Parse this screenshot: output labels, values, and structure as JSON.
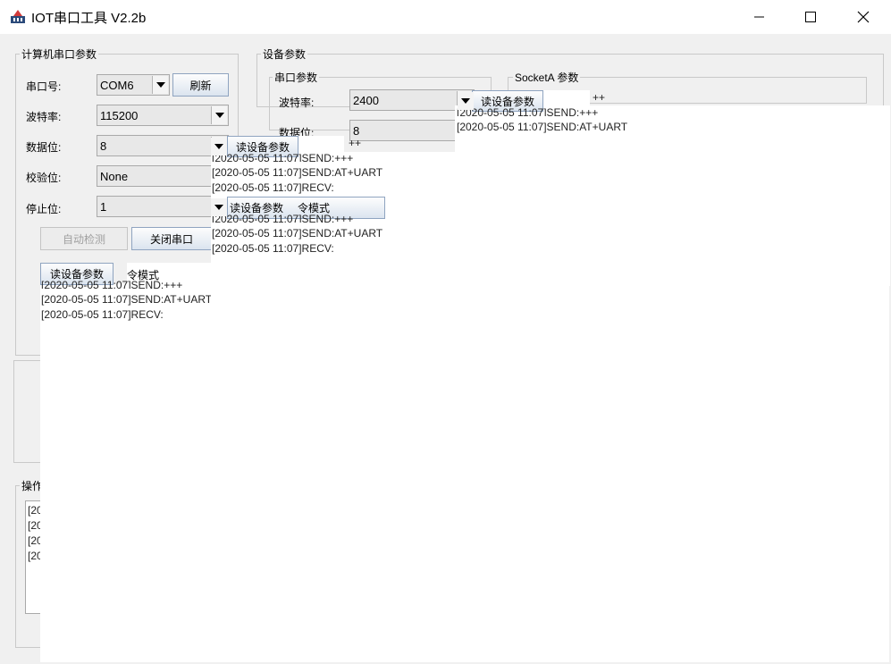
{
  "window": {
    "title": "IOT串口工具 V2.2b"
  },
  "computer_serial": {
    "group_title": "计算机串口参数",
    "port_label": "串口号:",
    "port_value": "COM6",
    "refresh_label": "刷新",
    "baud_label": "波特率:",
    "baud_value": "115200",
    "data_bits_label": "数据位:",
    "data_bits_value": "8",
    "parity_label": "校验位:",
    "parity_value": "None",
    "stop_bits_label": "停止位:",
    "stop_bits_value": "1",
    "auto_detect_label": "自动检测",
    "close_port_label": "关闭串口",
    "read_params_label": "读设备参数",
    "cmd_mode_fragment": "令模式"
  },
  "device_params": {
    "group_title": "设备参数",
    "serial_group_title": "串口参数",
    "baud_label": "波特率:",
    "baud_value": "2400",
    "data_bits_label": "数据位:",
    "data_bits_value": "8",
    "sockets_group_title": "SocketA 参数",
    "read_params_label": "读设备参数"
  },
  "operation_log": {
    "group_title_fragment": "操作",
    "line_fragment": "[20"
  },
  "ghost_artifacts": [
    {
      "read_label": "读设备参数",
      "lines": [
        "[2020-05-05 11:07]SEND:+++",
        "[2020-05-05 11:07]SEND:AT+UART"
      ],
      "partial_line": "++"
    },
    {
      "read_label": "读设备参数",
      "lines": [
        "[2020-05-05 11:07]SEND:+++",
        "[2020-05-05 11:07]SEND:AT+UART",
        "[2020-05-05 11:07]RECV:"
      ],
      "partial_line": "++"
    },
    {
      "read_label": "读设备参数",
      "cmd_fragment": "令模式",
      "lines": [
        "[2020-05-05 11:07]SEND:+++",
        "[2020-05-05 11:07]SEND:AT+UART",
        "[2020-05-05 11:07]RECV:"
      ]
    },
    {
      "lines": [
        "[2020-05-05 11:07]SEND:+++",
        "[2020-05-05 11:07]SEND:AT+UART",
        "[2020-05-05 11:07]RECV:"
      ]
    }
  ],
  "colors": {
    "background": "#f0f0f0",
    "button_border": "#8fa4c0",
    "white": "#ffffff"
  }
}
